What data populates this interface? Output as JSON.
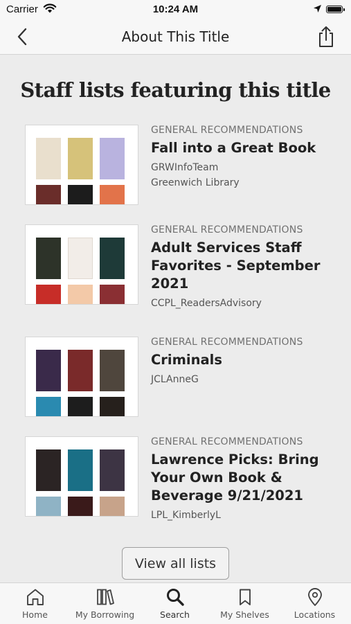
{
  "status_bar": {
    "carrier": "Carrier",
    "time": "10:24 AM"
  },
  "nav": {
    "title": "About This Title"
  },
  "heading": "Staff lists featuring this title",
  "lists": [
    {
      "category": "GENERAL RECOMMENDATIONS",
      "title": "Fall into a Great Book",
      "lines": [
        "GRWInfoTeam",
        "Greenwich Library"
      ]
    },
    {
      "category": "GENERAL RECOMMENDATIONS",
      "title": "Adult Services Staff Favorites - September 2021",
      "lines": [
        "CCPL_ReadersAdvisory"
      ]
    },
    {
      "category": "GENERAL RECOMMENDATIONS",
      "title": "Criminals",
      "lines": [
        "JCLAnneG"
      ]
    },
    {
      "category": "GENERAL RECOMMENDATIONS",
      "title": "Lawrence Picks: Bring Your Own Book & Beverage 9/21/2021",
      "lines": [
        "LPL_KimberlyL"
      ]
    }
  ],
  "view_all_label": "View all lists",
  "tabs": [
    {
      "label": "Home",
      "icon": "home-icon"
    },
    {
      "label": "My Borrowing",
      "icon": "books-icon"
    },
    {
      "label": "Search",
      "icon": "search-icon"
    },
    {
      "label": "My Shelves",
      "icon": "bookmark-icon"
    },
    {
      "label": "Locations",
      "icon": "location-pin-icon"
    }
  ],
  "colors": {
    "background": "#ececec",
    "bar": "#f7f7f7",
    "text": "#222222",
    "muted": "#707070"
  }
}
